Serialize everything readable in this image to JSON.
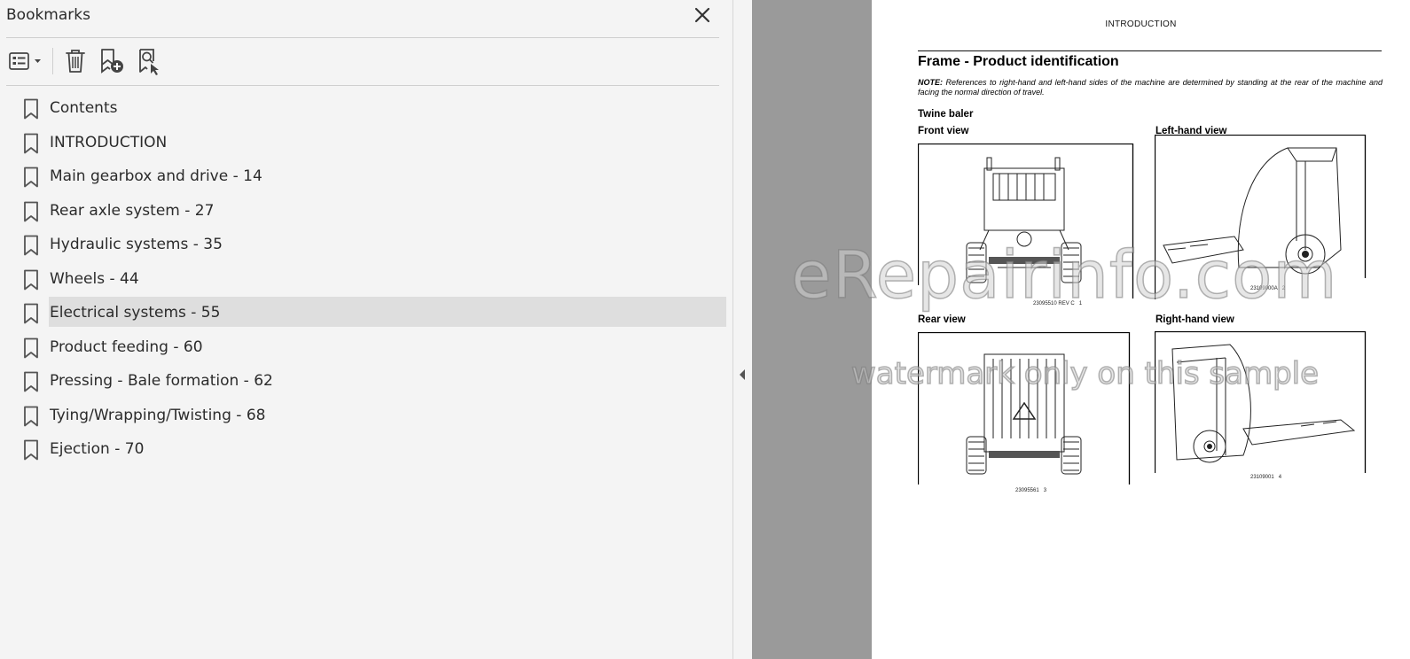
{
  "sidebar": {
    "title": "Bookmarks",
    "close_icon": "close-icon",
    "toolbar": {
      "options_icon": "list-options-icon",
      "delete_icon": "trash-icon",
      "new_bookmark_icon": "bookmark-add-icon",
      "find_bookmark_icon": "bookmark-search-icon"
    },
    "bookmarks": [
      {
        "label": "Contents"
      },
      {
        "label": "INTRODUCTION"
      },
      {
        "label": "Main gearbox and drive - 14"
      },
      {
        "label": "Rear axle system - 27"
      },
      {
        "label": "Hydraulic systems - 35"
      },
      {
        "label": "Wheels - 44"
      },
      {
        "label": "Electrical systems - 55",
        "selected": true
      },
      {
        "label": "Product feeding - 60"
      },
      {
        "label": "Pressing - Bale formation - 62"
      },
      {
        "label": "Tying/Wrapping/Twisting - 68"
      },
      {
        "label": "Ejection - 70"
      }
    ],
    "selected_color": "#dedede"
  },
  "document": {
    "header": "INTRODUCTION",
    "title": "Frame - Product identification",
    "note_label": "NOTE:",
    "note_text": "References to right-hand and left-hand sides of the machine are determined by standing at the rear of the machine and facing the normal direction of travel.",
    "section": "Twine baler",
    "figures": [
      {
        "label": "Front view",
        "code": "23095510 REV C",
        "number": "1"
      },
      {
        "label": "Left-hand view",
        "code": "23109000A",
        "number": "2"
      },
      {
        "label": "Rear view",
        "code": "23095561",
        "number": "3"
      },
      {
        "label": "Right-hand view",
        "code": "23109001",
        "number": "4"
      }
    ]
  },
  "watermark": {
    "line1": "eRepairinfo.com",
    "line2": "watermark only on this sample"
  },
  "colors": {
    "panel_bg": "#f4f4f4",
    "doc_bg": "#9a9a9a",
    "page_bg": "#ffffff"
  }
}
